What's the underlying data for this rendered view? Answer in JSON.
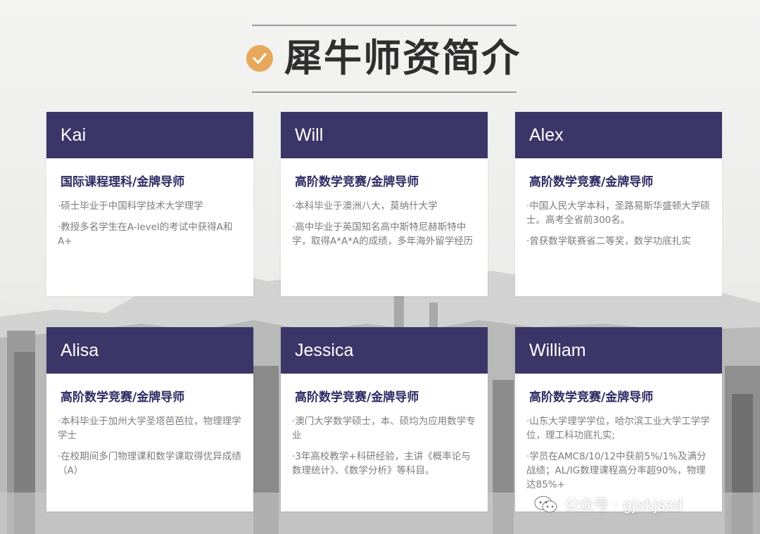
{
  "title": "犀牛师资简介",
  "colors": {
    "header_bg": "#3b3568",
    "accent": "#e8a85b",
    "role_text": "#2e2a63",
    "bullet_text": "#7c7c7c"
  },
  "icons": {
    "title_icon": "check-circle-icon",
    "watermark_icon": "wechat-icon"
  },
  "teachers": [
    {
      "name": "Kai",
      "role": "国际课程理科/金牌导师",
      "bullets": [
        "·硕士毕业于中国科学技术大学理学",
        "·教授多名学生在A-level的考试中获得A和A+"
      ]
    },
    {
      "name": "Will",
      "role": "高阶数学竞赛/金牌导师",
      "bullets": [
        "·本科毕业于澳洲八大，莫纳什大学",
        "·高中毕业于英国知名高中斯特尼赫斯特中学，取得A*A*A的成绩，多年海外留学经历"
      ]
    },
    {
      "name": "Alex",
      "role": "高阶数学竞赛/金牌导师",
      "bullets": [
        "·中国人民大学本科，圣路易斯华盛顿大学硕士。高考全省前300名。",
        "·曾获数学联赛省二等奖，数学功底扎实"
      ]
    },
    {
      "name": "Alisa",
      "role": "高阶数学竞赛/金牌导师",
      "bullets": [
        "·本科毕业于加州大学圣塔芭芭拉，物理理学学士",
        "·在校期间多门物理课和数学课取得优异成绩（A）"
      ]
    },
    {
      "name": "Jessica",
      "role": "高阶数学竞赛/金牌导师",
      "bullets": [
        "·澳门大学数学硕士，本、硕均为应用数学专业",
        "·3年高校教学+科研经验，主讲《概率论与数理统计》、《数学分析》等科目。"
      ]
    },
    {
      "name": "William",
      "role": "高阶数学竞赛/金牌导师",
      "bullets": [
        "·山东大学理学学位，哈尔滨工业大学工学学位，理工科功底扎实;",
        "·学员在AMC8/10/12中获前5%/1%及满分战绩；AL/IG数理课程高分率超90%，物理达85%+"
      ]
    }
  ],
  "watermark": "公众号 · gjxkjszd"
}
